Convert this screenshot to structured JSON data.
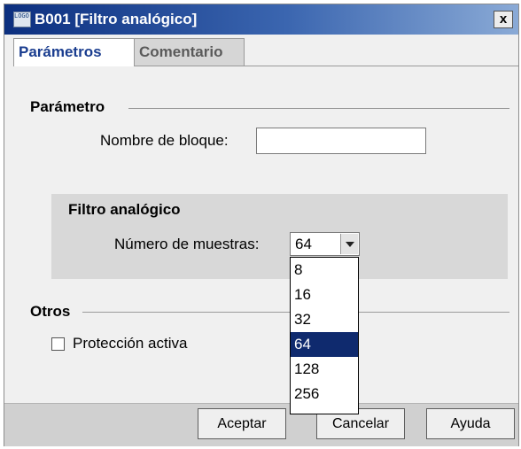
{
  "window": {
    "title": "B001 [Filtro analógico]",
    "icon_text": "LOGO!",
    "close_label": "x"
  },
  "tabs": [
    {
      "label": "Parámetros",
      "active": true
    },
    {
      "label": "Comentario",
      "active": false
    }
  ],
  "parameter_section": {
    "title": "Parámetro",
    "block_name_label": "Nombre de bloque:",
    "block_name_value": ""
  },
  "filter_group": {
    "title": "Filtro analógico",
    "samples_label": "Número de muestras:",
    "samples_value": "64",
    "options": [
      "8",
      "16",
      "32",
      "64",
      "128",
      "256"
    ],
    "selected_option": "64"
  },
  "others_section": {
    "title": "Otros",
    "protection_label": "Protección activa",
    "protection_checked": false
  },
  "buttons": {
    "accept": "Aceptar",
    "cancel": "Cancelar",
    "help": "Ayuda"
  },
  "colors": {
    "title_bar_start": "#0c2f7f",
    "selected_option_bg": "#0f2a6e",
    "active_tab_text": "#1a3d8f"
  }
}
